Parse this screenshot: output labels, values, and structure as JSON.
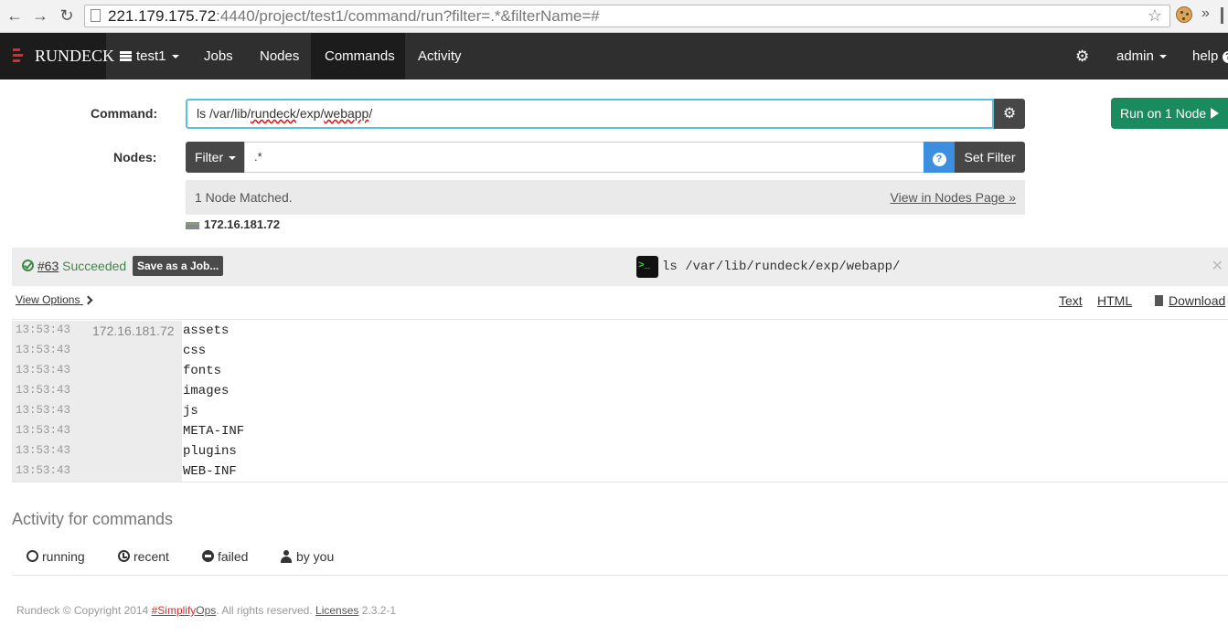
{
  "browser": {
    "url_host": "221.179.175.72",
    "url_rest": ":4440/project/test1/command/run?filter=.*&filterName=#",
    "back_icon": "arrow-left-icon",
    "forward_icon": "arrow-right-icon",
    "reload_icon": "reload-icon",
    "more_chevron": "»"
  },
  "nav": {
    "brand": "RUNDECK",
    "project": "test1",
    "items": [
      "Jobs",
      "Nodes",
      "Commands",
      "Activity"
    ],
    "active": "Commands",
    "user": "admin",
    "help": "help"
  },
  "command": {
    "label": "Command:",
    "value_parts": [
      "ls /var/lib/",
      "rundeck",
      "/exp/",
      "webapp",
      "/"
    ],
    "run_button": "Run on 1 Node"
  },
  "nodes": {
    "label": "Nodes:",
    "filter_button": "Filter",
    "filter_value": ".*",
    "set_filter_button": "Set Filter",
    "matched_text": "1 Node Matched.",
    "view_link": "View in Nodes Page »",
    "node_host": "172.16.181.72"
  },
  "execution": {
    "id": "#63",
    "status": "Succeeded",
    "save_button": "Save as a Job...",
    "command": "ls /var/lib/rundeck/exp/webapp/",
    "terminal_glyph": ">_",
    "view_options": "View Options",
    "format_text": "Text",
    "format_html": "HTML",
    "download": "Download",
    "output": [
      {
        "time": "13:53:43",
        "node": "172.16.181.72",
        "text": "assets"
      },
      {
        "time": "13:53:43",
        "node": "",
        "text": "css"
      },
      {
        "time": "13:53:43",
        "node": "",
        "text": "fonts"
      },
      {
        "time": "13:53:43",
        "node": "",
        "text": "images"
      },
      {
        "time": "13:53:43",
        "node": "",
        "text": "js"
      },
      {
        "time": "13:53:43",
        "node": "",
        "text": "META-INF"
      },
      {
        "time": "13:53:43",
        "node": "",
        "text": "plugins"
      },
      {
        "time": "13:53:43",
        "node": "",
        "text": "WEB-INF"
      }
    ]
  },
  "activity": {
    "title": "Activity for commands",
    "tabs": [
      "running",
      "recent",
      "failed",
      "by you"
    ]
  },
  "footer": {
    "prefix": "Rundeck © Copyright 2014 ",
    "simplify_hash": "#",
    "simplify_word1": "Simplify",
    "simplify_word2": "Ops",
    "middle": ". All rights reserved. ",
    "licenses": "Licenses",
    "version": " 2.3.2-1"
  },
  "colors": {
    "nav_bg": "#2f2f2f",
    "run_button": "#1a8a5f",
    "success_green": "#3f8a47",
    "help_blue": "#3b8ee0",
    "brand_red": "#e5262b"
  }
}
